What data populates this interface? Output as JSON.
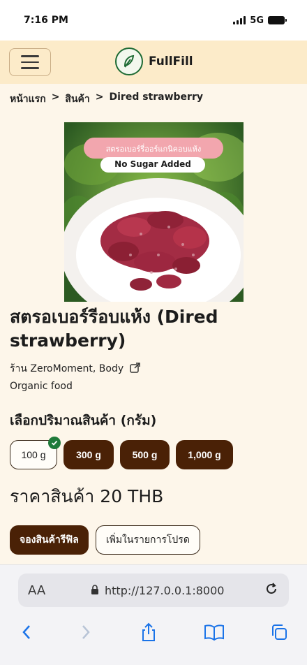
{
  "status_bar": {
    "time": "7:16 PM",
    "network": "5G"
  },
  "header": {
    "brand": "FullFill"
  },
  "breadcrumb": {
    "home": "หน้าแรก",
    "sep1": ">",
    "products": "สินค้า",
    "sep2": ">",
    "current": "Dired strawberry"
  },
  "product": {
    "image_banner_text": "สตรอเบอร์รี่ออร์แกนิคอบแห้ง",
    "image_label": "No Sugar Added",
    "title": "สตรอเบอร์รีอบแห้ง (Dired strawberry)",
    "shop": "ร้าน ZeroMoment, Body",
    "category": "Organic food",
    "quantity_heading": "เลือกปริมาณสินค้า (กรัม)",
    "quantities": [
      "100 g",
      "300 g",
      "500 g",
      "1,000 g"
    ],
    "selected_quantity": "100 g",
    "price": "ราคาสินค้า 20 THB"
  },
  "actions": {
    "reserve": "จองสินค้ารีฟิล",
    "wishlist": "เพิ่มในรายการโปรด"
  },
  "browser": {
    "aa": "AA",
    "url": "http://127.0.0.1:8000"
  },
  "colors": {
    "accent_brown": "#4a2106",
    "header_bg": "#fcebc9",
    "page_bg": "#fdf6ea",
    "check_green": "#1f7a3a"
  }
}
